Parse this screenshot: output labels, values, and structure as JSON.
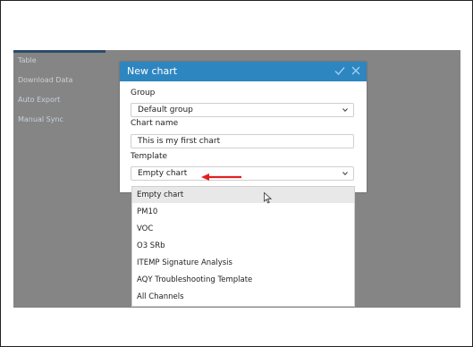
{
  "sidebar": {
    "items": [
      "Table",
      "Download Data",
      "Auto Export",
      "Manual Sync"
    ]
  },
  "dialog": {
    "title": "New chart",
    "group_label": "Group",
    "group_value": "Default group",
    "chart_name_label": "Chart name",
    "chart_name_value": "This is my first chart",
    "template_label": "Template",
    "template_value": "Empty chart"
  },
  "dropdown": {
    "options": [
      "Empty chart",
      "PM10",
      "VOC",
      "O3 SRb",
      "ITEMP Signature Analysis",
      "AQY Troubleshooting Template",
      "All Channels"
    ],
    "selected_index": 0
  },
  "colors": {
    "header": "#2e86c1",
    "overlay": "#858585",
    "annotation_arrow": "#e02020"
  }
}
